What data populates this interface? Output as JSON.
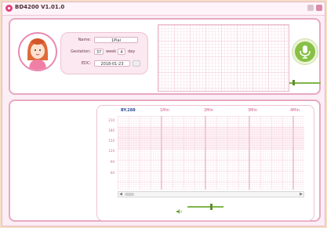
{
  "window": {
    "title": "BD4200 V1.01.0"
  },
  "patient": {
    "name_label": "Name:",
    "name_value": "1Plai",
    "gestation_label": "Gestation:",
    "gestation_week": "37",
    "week_unit": "week",
    "gestation_day": "4",
    "day_unit": "day",
    "edc_label": "EDC:",
    "edc_value": "2018-01-23"
  },
  "chart_header": [
    "BY.288",
    "1Min",
    "2Min",
    "3Min",
    "4Min"
  ],
  "y_ticks": [
    "210",
    "180",
    "150",
    "120",
    "90",
    "60"
  ],
  "colors": {
    "accent_pink": "#e989b1",
    "mic_green": "#88c046",
    "grid_pink": "#f1b9cc"
  }
}
